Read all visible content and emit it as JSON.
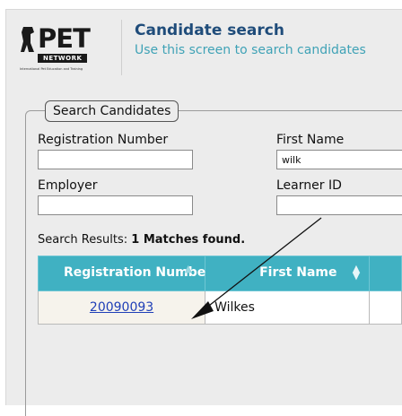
{
  "logo": {
    "letters": "PET",
    "network": "NETWORK",
    "tagline": "International Pet Education and Training"
  },
  "header": {
    "title": "Candidate search",
    "subtitle": "Use this screen to search candidates"
  },
  "search": {
    "legend": "Search Candidates",
    "registration_number_label": "Registration Number",
    "registration_number_value": "",
    "first_name_label": "First Name",
    "first_name_value": "wilk",
    "employer_label": "Employer",
    "employer_value": "",
    "learner_id_label": "Learner ID",
    "learner_id_value": ""
  },
  "results": {
    "prefix": "Search Results: ",
    "summary": "1 Matches found.",
    "columns": [
      "Registration Number",
      "First Name"
    ],
    "rows": [
      {
        "registration_number": "20090093",
        "first_name": "Wilkes"
      }
    ]
  },
  "colors": {
    "title": "#1f4c7a",
    "subtitle": "#3fa2b6",
    "table_header": "#40b1c2",
    "link": "#1f3fb7"
  }
}
